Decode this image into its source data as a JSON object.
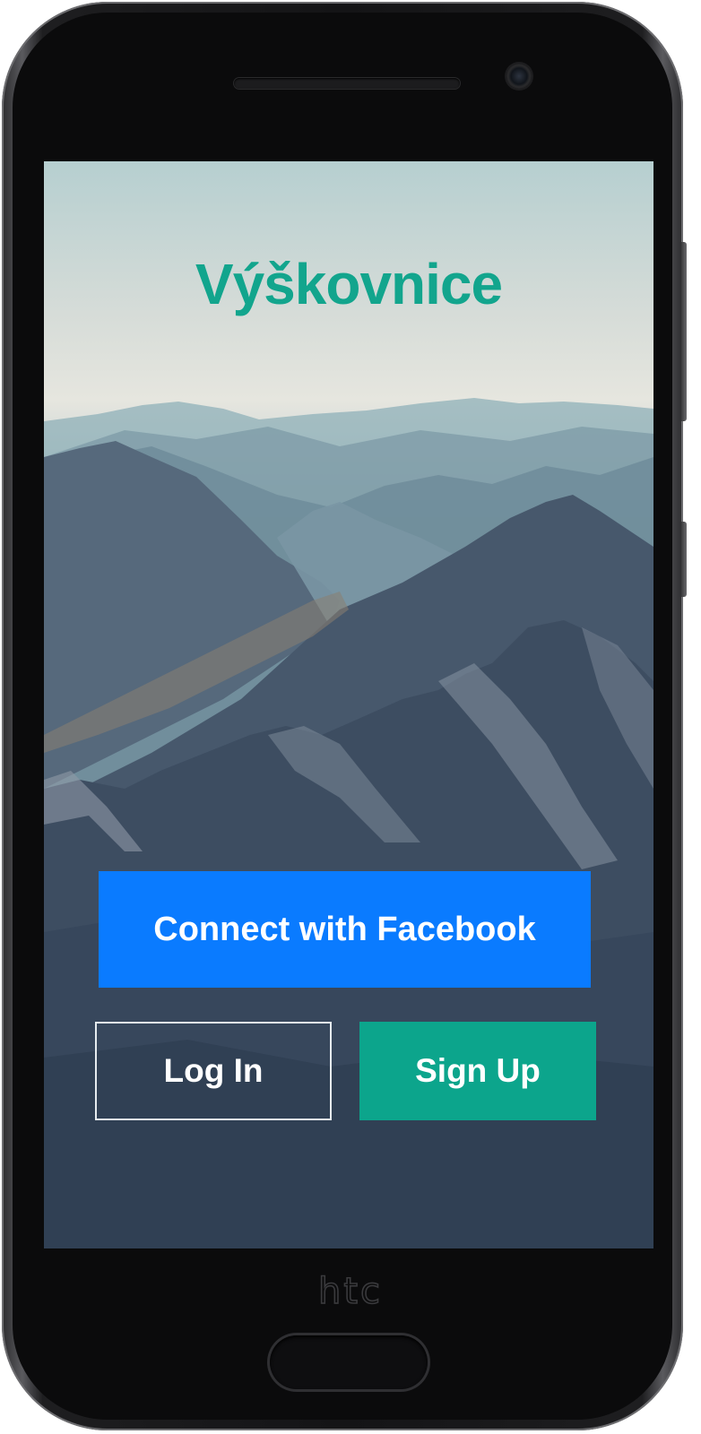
{
  "device": {
    "brand": "htc"
  },
  "app": {
    "title": "Výškovnice"
  },
  "actions": {
    "facebook_label": "Connect with Facebook",
    "login_label": "Log In",
    "signup_label": "Sign Up"
  },
  "colors": {
    "title": "#12a58d",
    "facebook": "#0a7bff",
    "signup": "#0ca58c",
    "login_border": "#e6ecef"
  },
  "icons": {
    "background": "mountain-landscape-image",
    "camera": "front-camera-icon",
    "speaker": "earpiece-speaker-icon",
    "home": "home-button-icon"
  }
}
